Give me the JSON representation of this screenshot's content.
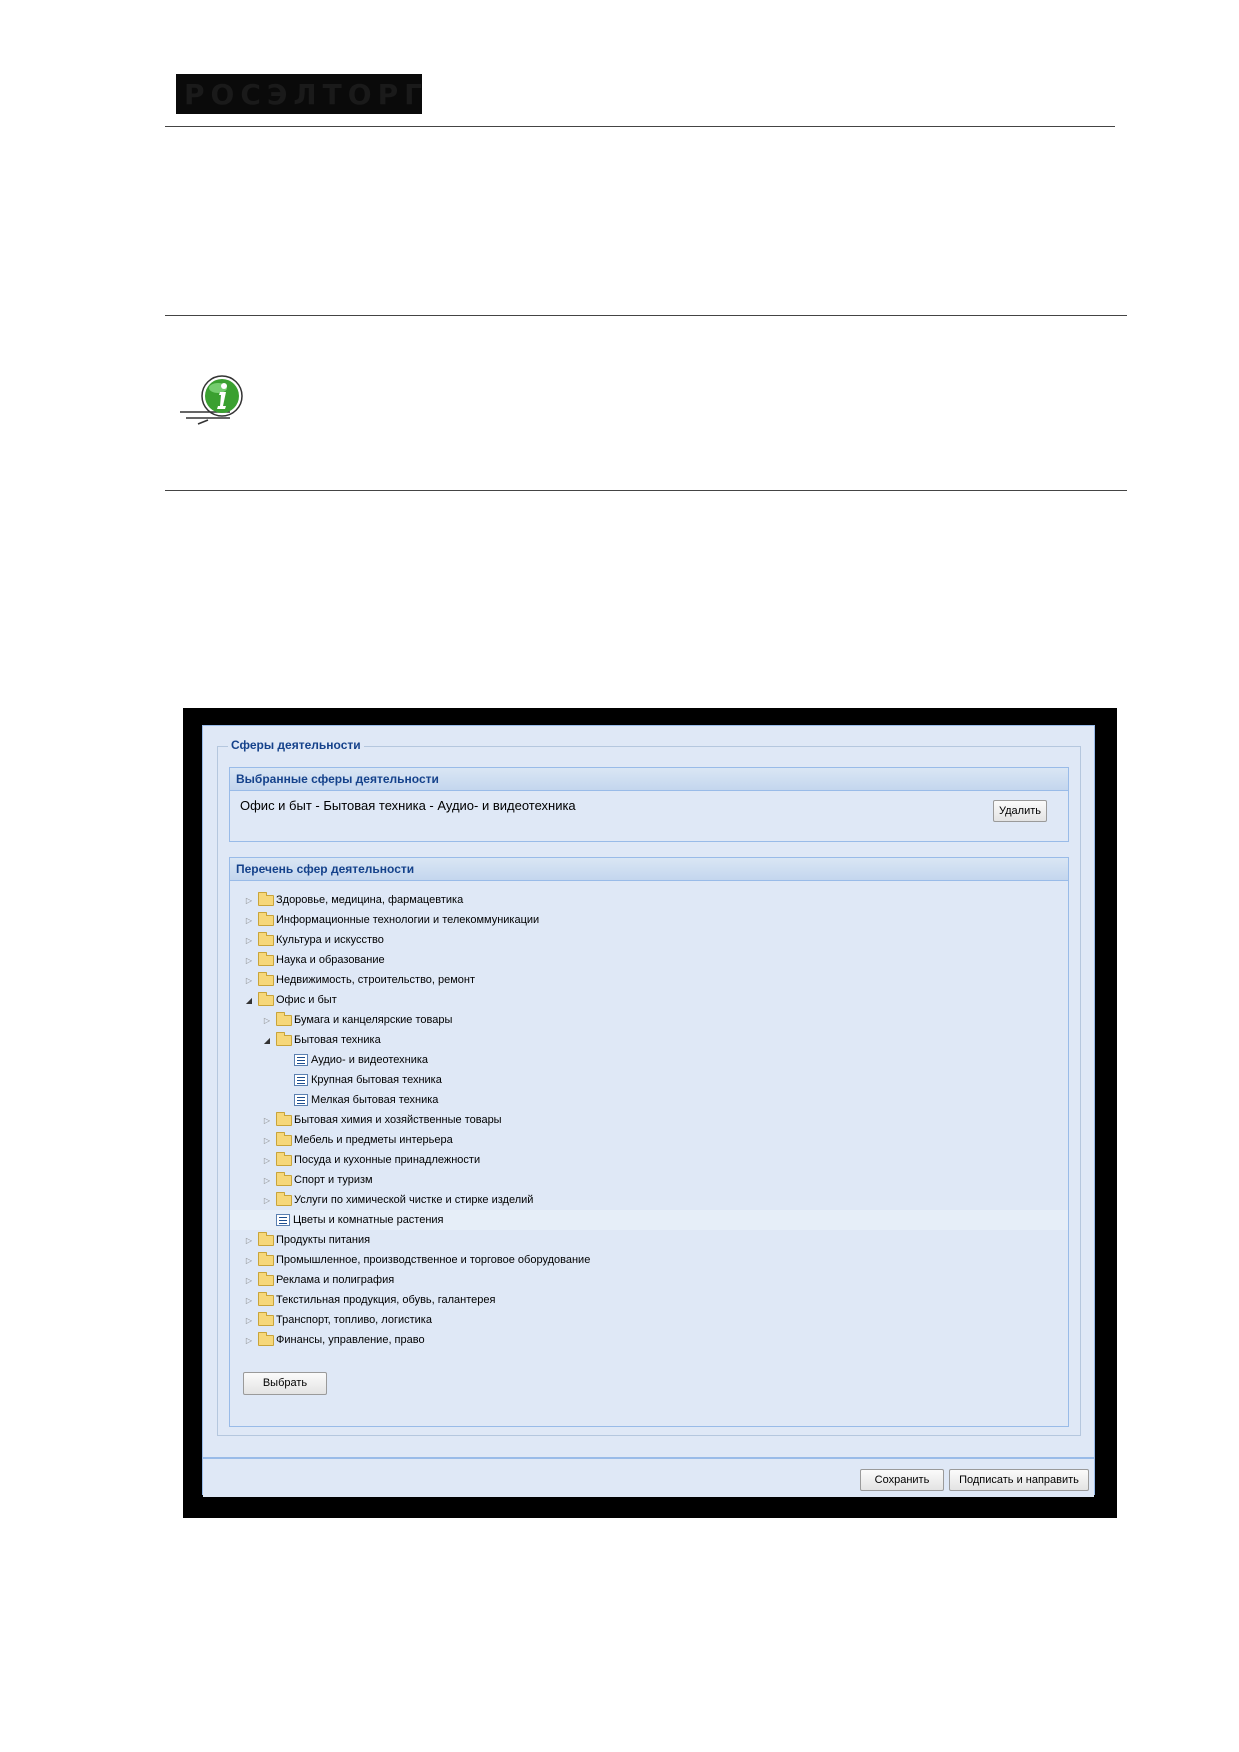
{
  "logo": {
    "text": "РОСЭЛТОРГ"
  },
  "window": {
    "fieldset_legend": "Сферы деятельности",
    "selected": {
      "title": "Выбранные сферы деятельности",
      "value": "Офис и быт - Бытовая техника - Аудио- и видеотехника",
      "delete_label": "Удалить"
    },
    "list": {
      "title": "Перечень сфер деятельности",
      "items": [
        {
          "label": "Здоровье, медицина, фармацевтика",
          "level": 0,
          "type": "folder",
          "state": "collapsed"
        },
        {
          "label": "Информационные технологии и телекоммуникации",
          "level": 0,
          "type": "folder",
          "state": "collapsed"
        },
        {
          "label": "Культура и искусство",
          "level": 0,
          "type": "folder",
          "state": "collapsed"
        },
        {
          "label": "Наука и образование",
          "level": 0,
          "type": "folder",
          "state": "collapsed"
        },
        {
          "label": "Недвижимость, строительство, ремонт",
          "level": 0,
          "type": "folder",
          "state": "collapsed"
        },
        {
          "label": "Офис и быт",
          "level": 0,
          "type": "folder",
          "state": "expanded"
        },
        {
          "label": "Бумага и канцелярские товары",
          "level": 1,
          "type": "folder",
          "state": "collapsed"
        },
        {
          "label": "Бытовая техника",
          "level": 1,
          "type": "folder",
          "state": "expanded"
        },
        {
          "label": "Аудио- и видеотехника",
          "level": 2,
          "type": "leaf",
          "state": "none"
        },
        {
          "label": "Крупная бытовая техника",
          "level": 2,
          "type": "leaf",
          "state": "none"
        },
        {
          "label": "Мелкая бытовая техника",
          "level": 2,
          "type": "leaf",
          "state": "none"
        },
        {
          "label": "Бытовая химия и хозяйственные товары",
          "level": 1,
          "type": "folder",
          "state": "collapsed"
        },
        {
          "label": "Мебель и предметы интерьера",
          "level": 1,
          "type": "folder",
          "state": "collapsed"
        },
        {
          "label": "Посуда и кухонные принадлежности",
          "level": 1,
          "type": "folder",
          "state": "collapsed"
        },
        {
          "label": "Спорт и туризм",
          "level": 1,
          "type": "folder",
          "state": "collapsed"
        },
        {
          "label": "Услуги по химической чистке и стирке изделий",
          "level": 1,
          "type": "folder",
          "state": "collapsed"
        },
        {
          "label": "Цветы и комнатные растения",
          "level": 1,
          "type": "leaf",
          "state": "none",
          "highlighted": true
        },
        {
          "label": "Продукты питания",
          "level": 0,
          "type": "folder",
          "state": "collapsed"
        },
        {
          "label": "Промышленное, производственное и торговое оборудование",
          "level": 0,
          "type": "folder",
          "state": "collapsed"
        },
        {
          "label": "Реклама и полиграфия",
          "level": 0,
          "type": "folder",
          "state": "collapsed"
        },
        {
          "label": "Текстильная продукция, обувь, галантерея",
          "level": 0,
          "type": "folder",
          "state": "collapsed"
        },
        {
          "label": "Транспорт, топливо, логистика",
          "level": 0,
          "type": "folder",
          "state": "collapsed"
        },
        {
          "label": "Финансы, управление, право",
          "level": 0,
          "type": "folder",
          "state": "collapsed"
        }
      ],
      "select_label": "Выбрать"
    },
    "footer": {
      "save_label": "Сохранить",
      "sign_label": "Подписать и направить"
    }
  },
  "colors": {
    "panel_bg": "#dfe8f6",
    "header_text": "#15428b",
    "border": "#99bbe8",
    "info_green": "#3aa030"
  }
}
